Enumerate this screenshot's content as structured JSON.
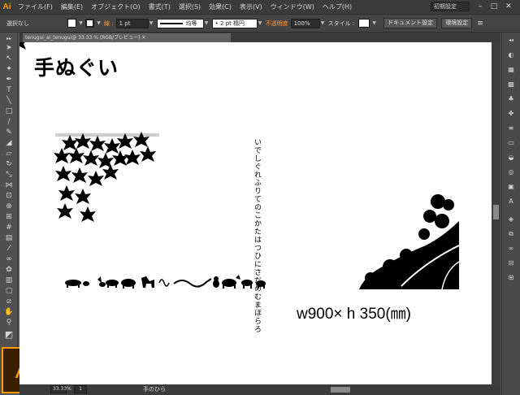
{
  "app": {
    "logo_text": "Ai"
  },
  "menu": [
    "ファイル(F)",
    "編集(E)",
    "オブジェクト(O)",
    "書式(T)",
    "選択(S)",
    "効果(C)",
    "表示(V)",
    "ウィンドウ(W)",
    "ヘルプ(H)"
  ],
  "workspace": "初期設定",
  "window_controls": {
    "minimize": "–",
    "maximize": "□",
    "close": "✕"
  },
  "control_bar": {
    "selection_status": "選択なし",
    "stroke_label": "線 :",
    "stroke_weight": "1 pt",
    "profile_label": "均等",
    "brush_label": "2 pt 楕円",
    "opacity_label": "不透明度",
    "opacity_value": "100%",
    "style_label": "スタイル :",
    "doc_setup_button": "ドキュメント設定",
    "prefs_button": "環境設定"
  },
  "document_tab": "tenugui_ai_tenugui@ 33.33 % (RGB/プレビュー) ✕",
  "canvas": {
    "title": "手ぬぐい",
    "dimensions_text": "w900× h 350(㎜)",
    "vertical_text": "いでしぐれふりてのこかたはつひにさだめむまほらろ"
  },
  "statusbar": {
    "zoom": "33.33%",
    "page": "1",
    "status_text": "手のひら"
  },
  "colors": {
    "accent": "#ff9a00",
    "canvas": "#ffffff",
    "ui_dark": "#535353"
  }
}
